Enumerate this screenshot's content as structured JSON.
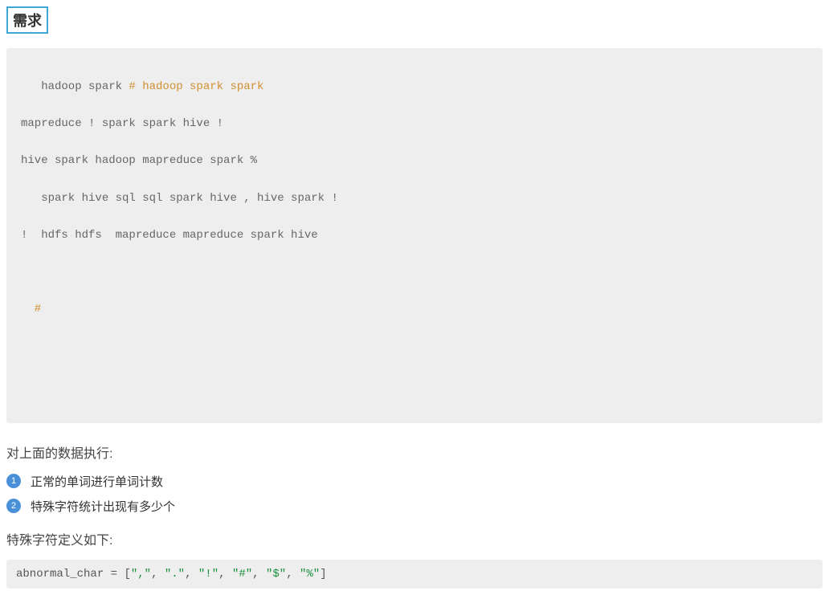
{
  "heading": "需求",
  "code_block": {
    "l1_pre": "   hadoop spark ",
    "l1_comment": "# hadoop spark spark",
    "l2": "mapreduce ! spark spark hive !",
    "l3": "hive spark hadoop mapreduce spark %",
    "l4": "   spark hive sql sql spark hive , hive spark !",
    "l5": "!  hdfs hdfs  mapreduce mapreduce spark hive",
    "l6": " ",
    "l7": "  #",
    "l8": " ",
    "l9": " "
  },
  "subheading1": "对上面的数据执行:",
  "list": [
    "正常的单词进行单词计数",
    "特殊字符统计出现有多少个"
  ],
  "subheading2": "特殊字符定义如下:",
  "abnormal": {
    "var": "abnormal_char",
    "eq": " = ",
    "lb": "[",
    "items": [
      "\",\"",
      "\".\"",
      "\"!\"",
      "\"#\"",
      "\"$\"",
      "\"%\""
    ],
    "sep": ", ",
    "rb": "]"
  }
}
